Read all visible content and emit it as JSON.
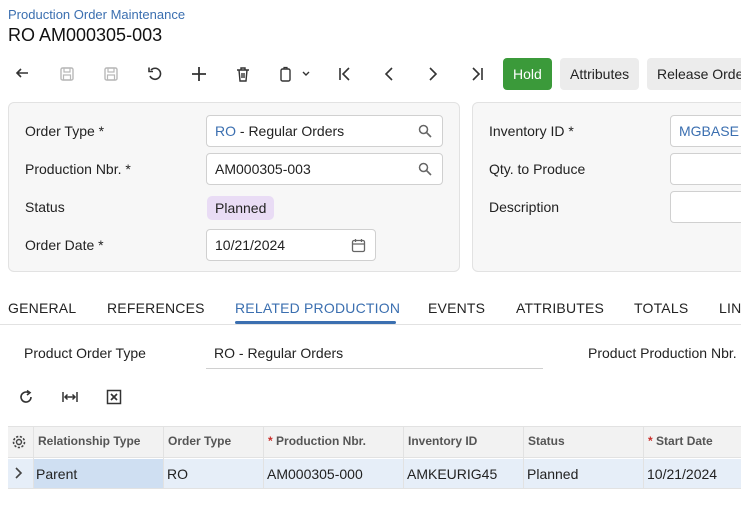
{
  "breadcrumb": "Production Order Maintenance",
  "title": "RO AM000305-003",
  "toolbar": {
    "icons": [
      "undo-back-icon",
      "save-icon",
      "save-close-icon",
      "cancel-icon",
      "add-icon",
      "delete-icon",
      "copy-paste-icon",
      "first-icon",
      "prev-icon",
      "next-icon",
      "last-icon"
    ],
    "hold_label": "Hold",
    "attributes_label": "Attributes",
    "release_label": "Release Order"
  },
  "summary": {
    "order_type_label": "Order Type",
    "order_type_code": "RO",
    "order_type_desc": " - Regular Orders",
    "production_nbr_label": "Production Nbr.",
    "production_nbr_value": "AM000305-003",
    "status_label": "Status",
    "status_value": "Planned",
    "order_date_label": "Order Date",
    "order_date_value": "10/21/2024",
    "required_mark": "*",
    "inventory_id_label": "Inventory ID",
    "inventory_id_value": "MGBASE",
    "qty_label": "Qty. to Produce",
    "description_label": "Description"
  },
  "tabs": [
    "GENERAL",
    "REFERENCES",
    "RELATED PRODUCTION",
    "EVENTS",
    "ATTRIBUTES",
    "TOTALS",
    "LIN"
  ],
  "active_tab": "RELATED PRODUCTION",
  "related": {
    "product_order_type_label": "Product Order Type",
    "product_order_type_value": "RO - Regular Orders",
    "product_production_nbr_label": "Product Production Nbr."
  },
  "grid": {
    "headers": [
      "Relationship Type",
      "Order Type",
      "Production Nbr.",
      "Inventory ID",
      "Status",
      "Start Date"
    ],
    "rows": [
      {
        "relationship_type": "Parent",
        "order_type": "RO",
        "production_nbr": "AM000305-000",
        "inventory_id": "AMKEURIG45",
        "status": "Planned",
        "start_date": "10/21/2024"
      }
    ]
  },
  "colors": {
    "accent": "#3b6fb0",
    "hold": "#3b9a3a",
    "status_badge": "#e9dcf5",
    "required": "#c9302c"
  }
}
